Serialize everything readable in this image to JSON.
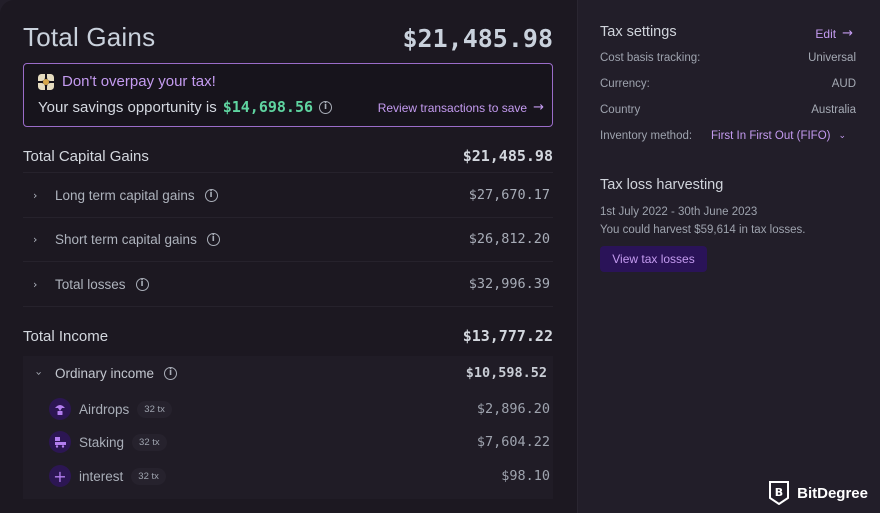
{
  "header": {
    "title": "Total Gains",
    "total": "$21,485.98"
  },
  "promo": {
    "icon": "flower-icon",
    "headline": "Don't overpay your tax!",
    "body_prefix": "Your savings opportunity is",
    "savings": "$14,698.56",
    "link_label": "Review transactions to save",
    "link_icon": "arrow-right-icon"
  },
  "capital_gains": {
    "title": "Total Capital Gains",
    "total": "$21,485.98",
    "rows": [
      {
        "label": "Long term capital gains",
        "amount": "$27,670.17"
      },
      {
        "label": "Short term capital gains",
        "amount": "$26,812.20"
      },
      {
        "label": "Total losses",
        "amount": "$32,996.39"
      }
    ]
  },
  "income": {
    "title": "Total Income",
    "total": "$13,777.22",
    "group": {
      "label": "Ordinary income",
      "amount": "$10,598.52",
      "items": [
        {
          "label": "Airdrops",
          "badge": "32 tx",
          "amount": "$2,896.20",
          "icon": "airdrop-icon"
        },
        {
          "label": "Staking",
          "badge": "32 tx",
          "amount": "$7,604.22",
          "icon": "staking-icon"
        },
        {
          "label": "interest",
          "badge": "32 tx",
          "amount": "$98.10",
          "icon": "plus-icon"
        }
      ]
    }
  },
  "tax_settings": {
    "title": "Tax settings",
    "edit_label": "Edit",
    "rows": [
      {
        "label": "Cost basis tracking:",
        "value": "Universal"
      },
      {
        "label": "Currency:",
        "value": "AUD"
      },
      {
        "label": "Country",
        "value": "Australia"
      }
    ],
    "inventory_label": "Inventory method:",
    "inventory_value": "First In First Out (FIFO)"
  },
  "harvesting": {
    "title": "Tax loss harvesting",
    "period": "1st July 2022 - 30th June 2023",
    "message": "You could harvest $59,614 in tax losses.",
    "button_label": "View tax losses"
  },
  "brand": {
    "name": "BitDegree"
  },
  "colors": {
    "accent": "#c49bf0",
    "savings_green": "#5fd4a0",
    "button_bg": "#2a1358",
    "panel_bg": "#1c1821",
    "page_bg": "#221e29"
  }
}
